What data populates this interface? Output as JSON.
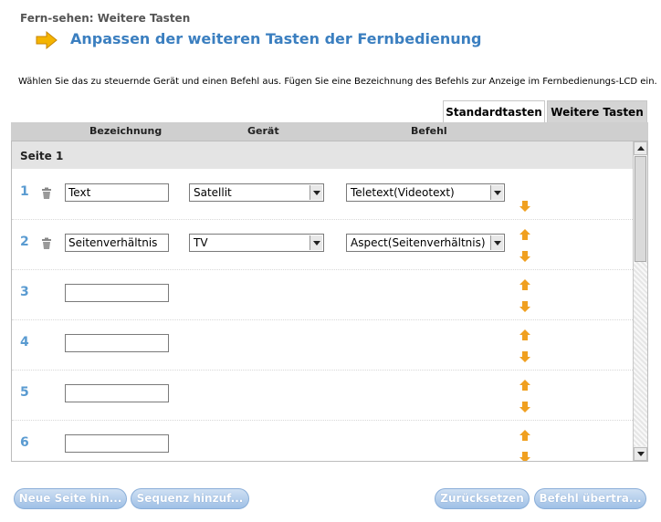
{
  "breadcrumb": "Fern-sehen: Weitere Tasten",
  "title": "Anpassen der weiteren Tasten der Fernbedienung",
  "instructions": "Wählen Sie das zu steuernde Gerät und einen Befehl aus. Fügen Sie eine Bezeichnung des Befehls zur Anzeige im Fernbedienungs-LCD ein.",
  "tabs": {
    "standard": "Standardtasten",
    "more": "Weitere Tasten"
  },
  "columns": {
    "name": "Bezeichnung",
    "device": "Gerät",
    "command": "Befehl"
  },
  "section": "Seite 1",
  "rows": [
    {
      "num": "1",
      "name": "Text",
      "device": "Satellit",
      "command": "Teletext(Videotext)"
    },
    {
      "num": "2",
      "name": "Seitenverhältnis",
      "device": "TV",
      "command": "Aspect(Seitenverhältnis)"
    },
    {
      "num": "3",
      "name": ""
    },
    {
      "num": "4",
      "name": ""
    },
    {
      "num": "5",
      "name": ""
    },
    {
      "num": "6",
      "name": ""
    }
  ],
  "buttons": {
    "new_page": "Neue Seite hin...",
    "add_sequence": "Sequenz hinzuf...",
    "reset": "Zurücksetzen",
    "transfer": "Befehl übertra..."
  },
  "colors": {
    "accent": "#3b7fc0",
    "row_number": "#5a9bd1",
    "arrow": "#f0a020",
    "button": "#a8c6ea"
  }
}
